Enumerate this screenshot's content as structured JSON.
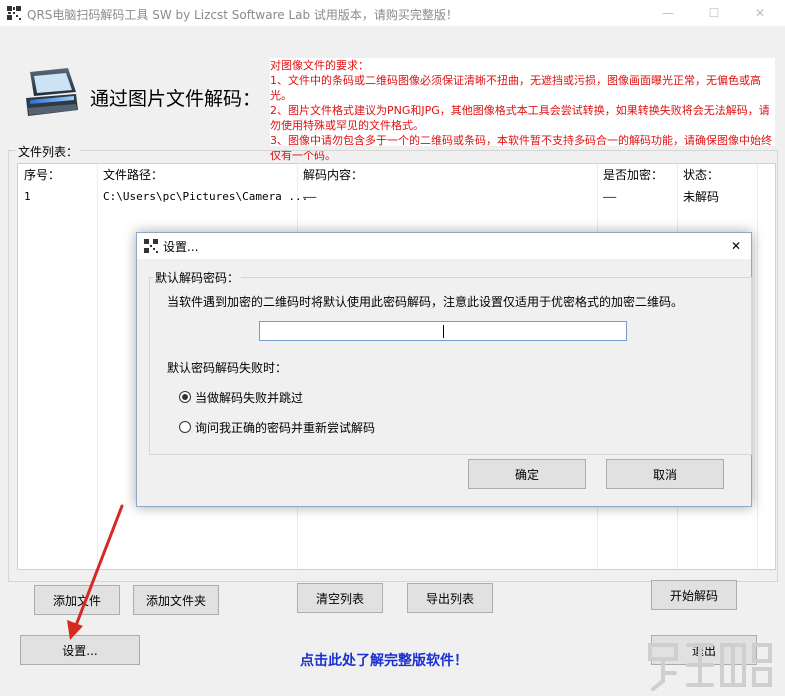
{
  "window": {
    "title": "QRS电脑扫码解码工具  SW  by Lizcst Software Lab 试用版本，请购买完整版！",
    "minimize_glyph": "—",
    "maximize_glyph": "☐",
    "close_glyph": "✕"
  },
  "header": {
    "title": "通过图片文件解码：",
    "requirements": "对图像文件的要求：\n1、文件中的条码或二维码图像必须保证清晰不扭曲，无遮挡或污损，图像画面曝光正常，无偏色或高光。\n2、图片文件格式建议为PNG和JPG，其他图像格式本工具会尝试转换，如果转换失败将会无法解码，请勿使用特殊或罕见的文件格式。\n3、图像中请勿包含多于一个的二维码或条码，本软件暂不支持多码合一的解码功能，请确保图像中始终仅有一个码。"
  },
  "file_list": {
    "label": "文件列表：",
    "columns": [
      "序号：",
      "文件路径：",
      "解码内容：",
      "是否加密：",
      "状态："
    ],
    "rows": [
      {
        "index": "1",
        "path": "C:\\Users\\pc\\Pictures\\Camera ...",
        "content": "——",
        "encrypted": "——",
        "status": "未解码"
      }
    ]
  },
  "buttons": {
    "add_file": "添加文件",
    "add_folder": "添加文件夹",
    "clear_list": "清空列表",
    "export_list": "导出列表",
    "start_decode": "开始解码",
    "settings": "设置...",
    "exit": "退出"
  },
  "promo_link": "点击此处了解完整版软件！",
  "dialog": {
    "title": "设置...",
    "close_glyph": "✕",
    "group_label": "默认解码密码：",
    "description": "当软件遇到加密的二维码时将默认使用此密码解码，注意此设置仅适用于优密格式的加密二维码。",
    "password_value": "",
    "fail_label": "默认密码解码失败时：",
    "options": [
      {
        "label": "当做解码失败并跳过",
        "selected": true
      },
      {
        "label": "询问我正确的密码并重新尝试解码",
        "selected": false
      }
    ],
    "ok": "确定",
    "cancel": "取消"
  },
  "colors": {
    "requirements_text": "#e01010",
    "link": "#1a2fd0",
    "arrow": "#d42a22",
    "dialog_border": "#8fa8c8"
  }
}
